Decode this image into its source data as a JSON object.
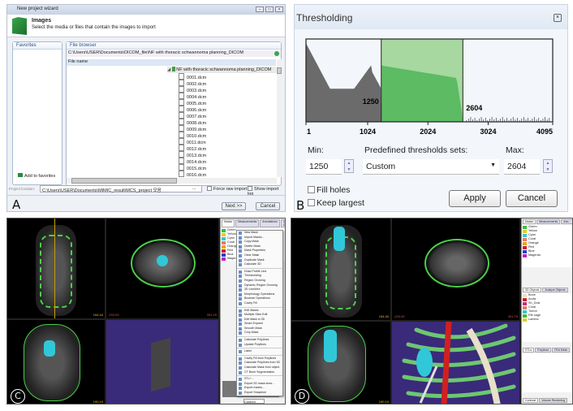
{
  "panel_labels": {
    "a": "A",
    "b": "B",
    "c": "C",
    "d": "D"
  },
  "panel_a": {
    "window_title": "New project wizard",
    "window_buttons": [
      "minimize",
      "maximize",
      "close"
    ],
    "header_title": "Images",
    "header_subtitle": "Select the media or files that contain the images to import",
    "favorites_label": "Favorites",
    "add_favorites": "Add to favorites",
    "file_browser_label": "File browser",
    "path": "C:\\Users\\USER\\Documents\\DICOM_file\\NF with thoracic schwannoma planning_DICOM",
    "column_header": "File name",
    "folder": "NF with thoracic schwannoma planning_DICOM",
    "files": [
      "0001.dcm",
      "0002.dcm",
      "0003.dcm",
      "0004.dcm",
      "0005.dcm",
      "0006.dcm",
      "0007.dcm",
      "0008.dcm",
      "0009.dcm",
      "0010.dcm",
      "0011.dcm",
      "0012.dcm",
      "0013.dcm",
      "0014.dcm",
      "0015.dcm",
      "0016.dcm"
    ],
    "project_location_label": "Project location:",
    "project_location": "C:\\Users\\USER\\Documents\\MIMIC_result\\MCS_project 모음",
    "browse": "...",
    "force_raw_import": "Force raw import",
    "show_import_log": "Show import log",
    "next": "Next >>",
    "cancel": "Cancel"
  },
  "panel_b": {
    "title": "Thresholding",
    "histogram": {
      "axis_min": 1,
      "axis_max": 4095,
      "ticks": [
        "1",
        "1024",
        "2024",
        "3024",
        "4095"
      ],
      "selected_range": [
        1250,
        2604
      ],
      "min_marker": "1250",
      "max_marker": "2604",
      "colors": {
        "outside": "#6b6b6b",
        "selected_fill": "#5cbb63",
        "selected_bg": "#a6d8a0"
      }
    },
    "min_label": "Min:",
    "min_value": "1250",
    "preset_label": "Predefined thresholds sets:",
    "preset_value": "Custom",
    "max_label": "Max:",
    "max_value": "2604",
    "fill_holes": "Fill holes",
    "keep_largest": "Keep largest",
    "apply": "Apply",
    "cancel": "Cancel"
  },
  "panel_c": {
    "readouts": [
      "154.44",
      "-233.00",
      "301.29",
      "190.19"
    ],
    "tabs": [
      "Masks",
      "Measurements",
      "Annotations",
      "Cross Objects"
    ],
    "mask_columns": [
      "Name",
      "Vi...",
      "Va...",
      "Lowe...",
      "High..."
    ],
    "masks": [
      {
        "name": "Green",
        "color": "#3cc03c"
      },
      {
        "name": "Yellow",
        "color": "#e0d020"
      },
      {
        "name": "Cyan",
        "color": "#30c8d8"
      },
      {
        "name": "Coral",
        "color": "#f07860"
      },
      {
        "name": "Orange",
        "color": "#f0a020"
      },
      {
        "name": "Red",
        "color": "#d02020"
      },
      {
        "name": "Blue",
        "color": "#2040d0"
      },
      {
        "name": "Magenta",
        "color": "#c020c0"
      }
    ],
    "context_menu": [
      "New Mask",
      "Import Masks...",
      "Copy Mask",
      "Delete Mask",
      "Mask Properties",
      "Clear Mask",
      "Duplicate Mask",
      "Calculate 3D",
      "Draw Profile Line",
      "Thresholding",
      "Region Growing",
      "Dynamic Region Growing",
      "3D LiveWire",
      "Morphology Operations",
      "Boolean Operations",
      "Cavity Fill",
      "Edit Masks",
      "Multiple Slice Edit",
      "Edit Mask in 3D",
      "Smart Expand",
      "Smooth Mask",
      "Crop Mask",
      "Calculate Polylines",
      "Update Polylines",
      "Label",
      "Cavity Fill from Polylines",
      "Calculate Polylines from 3D",
      "Calculate Mask from object",
      "CT Bone Segmentation",
      "STL+...",
      "Export 2D mask area...",
      "Export masks...",
      "Export Snapshot"
    ],
    "preset": "Custom"
  },
  "panel_d": {
    "readouts": [
      "154.40",
      "-233.00",
      "301.75",
      "190.19"
    ],
    "tabs": [
      "Masks",
      "Measurements",
      "Ann..."
    ],
    "masks": [
      {
        "name": "Green",
        "color": "#3cc03c"
      },
      {
        "name": "Yellow",
        "color": "#e0d020"
      },
      {
        "name": "Cyan",
        "color": "#30c8d8"
      },
      {
        "name": "Coral",
        "color": "#f07860"
      },
      {
        "name": "Orange",
        "color": "#f0a020"
      },
      {
        "name": "Red",
        "color": "#d02020"
      },
      {
        "name": "Blue",
        "color": "#2040d0"
      },
      {
        "name": "Magenta",
        "color": "#c020c0"
      }
    ],
    "object_tabs": [
      "3D Objects",
      "Analyze Objects"
    ],
    "objects": [
      {
        "name": "Bone",
        "color": "#e8e0c8"
      },
      {
        "name": "Aorta",
        "color": "#d02020"
      },
      {
        "name": "Sh_Dosi",
        "color": "#c03080"
      },
      {
        "name": "Coral",
        "color": "#f07860"
      },
      {
        "name": "Tumor",
        "color": "#30c8d8"
      },
      {
        "name": "Rib cage",
        "color": "#3cc03c"
      },
      {
        "name": "Lamina",
        "color": "#e0d020"
      }
    ],
    "bottom_tabs": [
      "STLs",
      "Polylines",
      "FEA Mesh"
    ],
    "footer_tabs": [
      "Contrast",
      "Volume Rendering"
    ]
  }
}
